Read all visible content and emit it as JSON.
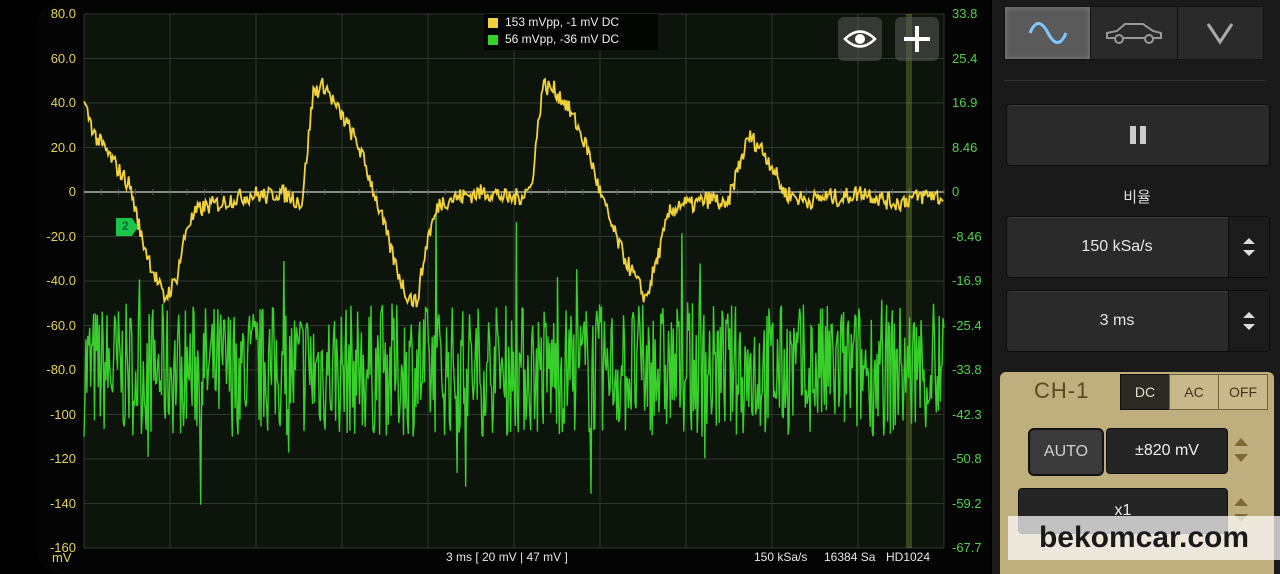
{
  "legend": {
    "ch1": "153 mVpp, -1 mV DC",
    "ch2": "56 mVpp, -36 mV DC",
    "ch1_color": "#f2d23c",
    "ch2_color": "#38d02a"
  },
  "y_axis_left": [
    "80.0",
    "60.0",
    "40.0",
    "20.0",
    "0",
    "-20.0",
    "-40.0",
    "-60.0",
    "-80.0",
    "-100",
    "-120",
    "-140",
    "-160"
  ],
  "y_axis_right": [
    "33.8",
    "25.4",
    "16.9",
    "8.46",
    "0",
    "-8.46",
    "-16.9",
    "-25.4",
    "-33.8",
    "-42.3",
    "-50.8",
    "-59.2",
    "-67.7"
  ],
  "unit": "mV",
  "ch2_marker": "2",
  "bottom": {
    "timebase": "3 ms  [ 20 mV | 47 mV ]",
    "rate": "150 kSa/s",
    "samples": "16384 Sa",
    "hd": "HD1024"
  },
  "overlay_buttons": [
    "eye-icon",
    "plus-icon"
  ],
  "panel": {
    "tabs": [
      "scope-wave-icon",
      "car-icon",
      "chevron-down-icon"
    ],
    "ratio_label": "비율",
    "samplerate": "150 kSa/s",
    "timebase": "3 ms",
    "pause_icon": "pause-icon",
    "channel": {
      "title": "CH-1",
      "coupling": [
        "DC",
        "AC",
        "OFF"
      ],
      "coupling_selected": "DC",
      "auto": "AUTO",
      "range": "±820 mV",
      "probe": "x1"
    }
  },
  "watermark": "bekomcar.com",
  "chart_data": {
    "type": "line",
    "series": [
      {
        "name": "153 mVpp, -1 mV DC",
        "x": [
          0,
          0.4,
          0.8,
          1.2,
          1.6,
          2.0,
          2.4,
          2.8,
          3.2,
          3.6,
          4.0,
          4.4,
          4.8,
          5.2,
          5.6,
          6.0,
          6.4,
          6.8,
          7.2,
          7.6,
          8.0,
          8.4,
          8.8,
          9.2,
          9.6,
          10.0,
          10.4,
          10.8,
          11.2,
          11.6,
          12.0,
          12.4,
          12.8,
          13.2,
          13.6,
          14.0,
          14.4,
          14.8,
          15.2,
          15.6,
          16.0,
          16.4,
          16.8,
          17.2,
          17.6,
          18.0,
          18.4,
          18.8,
          19.2,
          19.6,
          20.0,
          20.4,
          20.8,
          21.2,
          21.6,
          22.0,
          22.4,
          22.8,
          23.2,
          23.6,
          24.0,
          24.4,
          24.8,
          25.2,
          25.6,
          26.0,
          26.4,
          26.8,
          27.2,
          27.6,
          28.0,
          28.4,
          28.8,
          29.2,
          29.6,
          30.0
        ],
        "y": [
          40,
          25,
          18,
          10,
          3,
          -20,
          -35,
          -48,
          -40,
          -15,
          -8,
          -6,
          -5,
          -3,
          -2,
          -1,
          -2,
          0,
          -2,
          -5,
          45,
          48,
          38,
          30,
          20,
          5,
          -12,
          -30,
          -45,
          -50,
          -20,
          -5,
          -3,
          -2,
          -1,
          0,
          -1,
          -3,
          -2,
          2,
          48,
          46,
          40,
          30,
          18,
          0,
          -15,
          -28,
          -38,
          -48,
          -30,
          -10,
          -5,
          -6,
          -4,
          -3,
          -8,
          10,
          25,
          20,
          12,
          0,
          -2,
          -4,
          -3,
          -2,
          -3,
          -1,
          0,
          -2,
          -4,
          -5,
          -3,
          -2,
          -1,
          -4
        ]
      },
      {
        "name": "56 mVpp, -36 mV DC",
        "x_range": [
          0,
          30
        ],
        "y_mean": -80,
        "y_pp": 56
      }
    ],
    "xlabel": "",
    "ylabel": "mV",
    "ylim_left": [
      -160,
      80
    ],
    "ylim_right": [
      -67.7,
      33.8
    ],
    "x_divisions": 10,
    "grid": true
  }
}
